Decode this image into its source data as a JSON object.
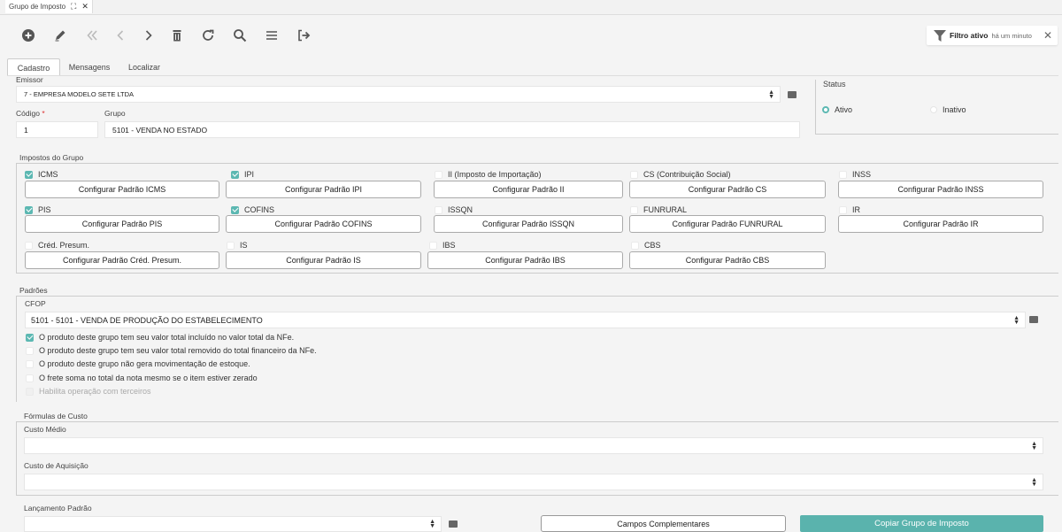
{
  "doc_tab": {
    "title": "Grupo de Imposto"
  },
  "filter": {
    "label": "Filtro ativo",
    "time": "há um minuto"
  },
  "tabs": [
    "Cadastro",
    "Mensagens",
    "Localizar"
  ],
  "emissor": {
    "label": "Emissor",
    "value": "7 - EMPRESA MODELO SETE LTDA"
  },
  "codigo": {
    "label": "Código",
    "required": "*",
    "value": "1"
  },
  "grupo": {
    "label": "Grupo",
    "value": "5101 - VENDA NO ESTADO"
  },
  "status": {
    "label": "Status",
    "options": [
      {
        "label": "Ativo",
        "selected": true
      },
      {
        "label": "Inativo",
        "selected": false
      }
    ]
  },
  "impostos": {
    "title": "Impostos do Grupo",
    "items": [
      {
        "label": "ICMS",
        "checked": true,
        "button": "Configurar Padrão ICMS"
      },
      {
        "label": "IPI",
        "checked": true,
        "button": "Configurar Padrão IPI"
      },
      {
        "label": "II (Imposto de Importação)",
        "checked": false,
        "button": "Configurar Padrão II"
      },
      {
        "label": "CS (Contribuição Social)",
        "checked": false,
        "button": "Configurar Padrão CS"
      },
      {
        "label": "INSS",
        "checked": false,
        "button": "Configurar Padrão INSS"
      },
      {
        "label": "PIS",
        "checked": true,
        "button": "Configurar Padrão PIS"
      },
      {
        "label": "COFINS",
        "checked": true,
        "button": "Configurar Padrão COFINS"
      },
      {
        "label": "ISSQN",
        "checked": false,
        "button": "Configurar Padrão ISSQN"
      },
      {
        "label": "FUNRURAL",
        "checked": false,
        "button": "Configurar Padrão FUNRURAL"
      },
      {
        "label": "IR",
        "checked": false,
        "button": "Configurar Padrão IR"
      },
      {
        "label": "Créd. Presum.",
        "checked": false,
        "button": "Configurar Padrão Créd. Presum."
      },
      {
        "label": "IS",
        "checked": false,
        "button": "Configurar Padrão IS"
      },
      {
        "label": "IBS",
        "checked": false,
        "button": "Configurar Padrão IBS"
      },
      {
        "label": "CBS",
        "checked": false,
        "button": "Configurar Padrão CBS"
      }
    ]
  },
  "padroes": {
    "title": "Padrões",
    "cfop_label": "CFOP",
    "cfop_value": "5101 - 5101 - VENDA DE PRODUÇÃO DO ESTABELECIMENTO",
    "options": [
      {
        "label": "O produto deste grupo tem seu valor total incluído no valor total da NFe.",
        "checked": true,
        "disabled": false
      },
      {
        "label": "O produto deste grupo tem seu valor total removido do total financeiro da NFe.",
        "checked": false,
        "disabled": false
      },
      {
        "label": "O produto deste grupo não gera movimentação de estoque.",
        "checked": false,
        "disabled": false
      },
      {
        "label": "O frete soma no total da nota mesmo se o item estiver zerado",
        "checked": false,
        "disabled": false
      },
      {
        "label": "Habilita operação com terceiros",
        "checked": false,
        "disabled": true
      }
    ]
  },
  "formulas": {
    "title": "Fórmulas de Custo",
    "custo_medio_label": "Custo Médio",
    "custo_medio_value": "",
    "custo_aquisicao_label": "Custo de Aquisição",
    "custo_aquisicao_value": ""
  },
  "lancamento": {
    "label": "Lançamento Padrão",
    "value": ""
  },
  "buttons": {
    "campos": "Campos Complementares",
    "copiar": "Copiar Grupo de Imposto"
  },
  "colors": {
    "accent": "#5cb8b2",
    "button_teal": "#5ab3ad"
  }
}
